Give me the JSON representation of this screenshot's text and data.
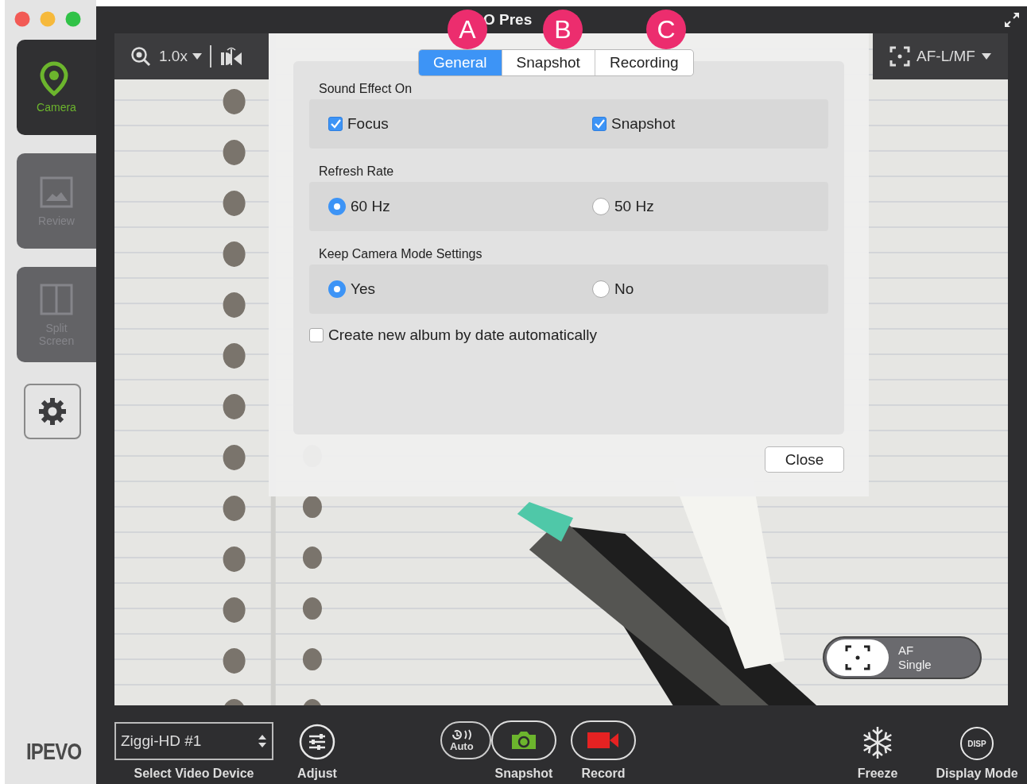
{
  "window": {
    "title": "O Pres"
  },
  "annotations": [
    {
      "label": "A"
    },
    {
      "label": "B"
    },
    {
      "label": "C"
    }
  ],
  "sidebar": {
    "items": [
      {
        "kind": "camera",
        "label": "Camera",
        "selected": true
      },
      {
        "kind": "review",
        "label": "Review",
        "selected": false
      },
      {
        "kind": "split",
        "label": "Split Screen",
        "selected": false
      }
    ],
    "brand": "IPEVO"
  },
  "viewer": {
    "zoom": "1.0x",
    "focus_mode": "AF-L/MF",
    "af_badge": {
      "line_1": "AF",
      "line_2": "Single"
    }
  },
  "dialog": {
    "tabs": [
      {
        "label": "General",
        "selected": true
      },
      {
        "label": "Snapshot",
        "selected": false
      },
      {
        "label": "Recording",
        "selected": false
      }
    ],
    "sections": [
      {
        "title": "Sound Effect On",
        "options": [
          {
            "kind": "checkbox",
            "label": "Focus",
            "checked": true
          },
          {
            "kind": "checkbox",
            "label": "Snapshot",
            "checked": true
          }
        ]
      },
      {
        "title": "Refresh Rate",
        "options": [
          {
            "kind": "radio",
            "label": "60 Hz",
            "selected": true
          },
          {
            "kind": "radio",
            "label": "50 Hz",
            "selected": false
          }
        ]
      },
      {
        "title": "Keep Camera Mode Settings",
        "options": [
          {
            "kind": "radio",
            "label": "Yes",
            "selected": true
          },
          {
            "kind": "radio",
            "label": "No",
            "selected": false
          }
        ]
      }
    ],
    "album_option": {
      "label": "Create new album by date automatically",
      "checked": false
    },
    "close_button": "Close"
  },
  "toolbar": {
    "device": "Ziggi-HD #1",
    "device_label": "Select Video Device",
    "auto": "Auto",
    "disp": "DISP",
    "buttons": [
      {
        "kind": "adjust",
        "label": "Adjust"
      },
      {
        "kind": "snapshot",
        "label": "Snapshot"
      },
      {
        "kind": "record",
        "label": "Record"
      },
      {
        "kind": "freeze",
        "label": "Freeze"
      },
      {
        "kind": "display",
        "label": "Display Mode"
      }
    ]
  }
}
